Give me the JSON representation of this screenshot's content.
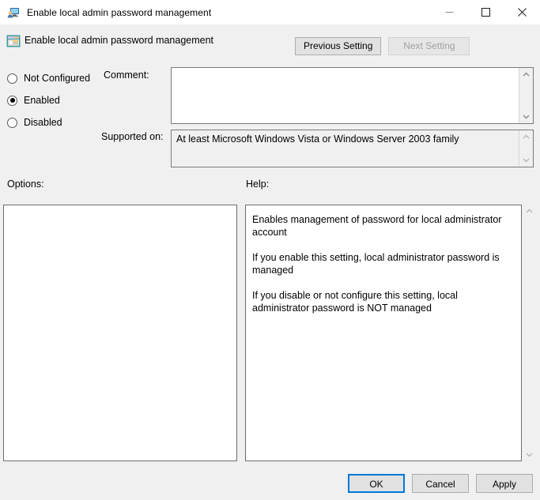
{
  "window": {
    "title": "Enable local admin password management",
    "icon": "computer-user-icon",
    "controls": {
      "minimize": "minimize-icon",
      "maximize": "maximize-icon",
      "close": "close-icon"
    }
  },
  "header": {
    "icon": "policy-setting-icon",
    "title": "Enable local admin password management",
    "previous_setting_label": "Previous Setting",
    "next_setting_label": "Next Setting",
    "next_setting_disabled": true
  },
  "state_options": {
    "selected": "Enabled",
    "items": [
      {
        "label": "Not Configured",
        "checked": false
      },
      {
        "label": "Enabled",
        "checked": true
      },
      {
        "label": "Disabled",
        "checked": false
      }
    ]
  },
  "comment": {
    "label": "Comment:",
    "value": "",
    "placeholder": ""
  },
  "supported_on": {
    "label": "Supported on:",
    "value": "At least Microsoft Windows Vista or Windows Server 2003 family"
  },
  "options": {
    "label": "Options:",
    "content": ""
  },
  "help": {
    "label": "Help:",
    "paragraphs": [
      "Enables management of password for local administrator account",
      "If you enable this setting, local administrator password is managed",
      "If you disable or not configure this setting, local administrator password is NOT managed"
    ]
  },
  "footer": {
    "ok_label": "OK",
    "cancel_label": "Cancel",
    "apply_label": "Apply"
  },
  "colors": {
    "dialog_background": "#f0f0f0",
    "titlebar_background": "#ffffff",
    "field_border": "#7a7a7a",
    "panel_border": "#6e6e6e",
    "button_face": "#e1e1e1",
    "button_border": "#adadad",
    "accent_focus": "#0078d7",
    "disabled_text": "#a0a0a0"
  }
}
